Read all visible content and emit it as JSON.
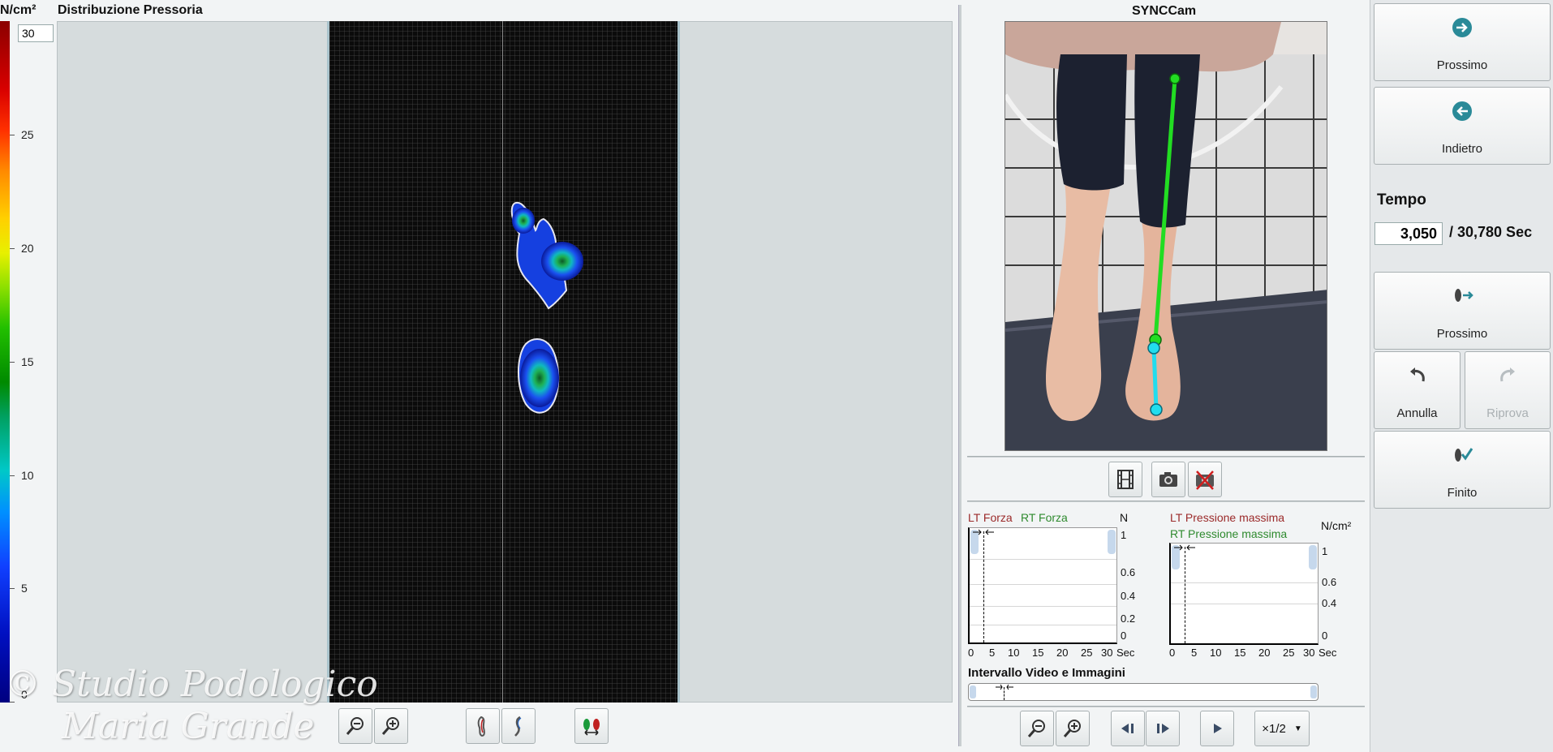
{
  "pressure_panel": {
    "unit": "N/cm²",
    "title": "Distribuzione Pressoria",
    "max_value": "30",
    "scale_ticks": [
      "25",
      "20",
      "15",
      "10",
      "5",
      "0"
    ]
  },
  "watermark": {
    "line1": "© Studio Podologico",
    "line2": "Maria Grande"
  },
  "left_toolbar": {
    "icons": [
      "zoom-out-icon",
      "zoom-in-icon",
      "foot-outline-icon",
      "foot-line-icon",
      "swap-feet-icon"
    ]
  },
  "camera": {
    "title": "SYNCCam"
  },
  "camera_toolbar": {
    "icons": [
      "film-icon",
      "camera-icon",
      "camera-off-icon"
    ]
  },
  "force_graph": {
    "left_label": "LT Forza",
    "right_label": "RT Forza",
    "unit": "N",
    "y_ticks": [
      "1",
      "0.6",
      "0.4",
      "0.2",
      "0"
    ],
    "x_ticks": [
      "0",
      "5",
      "10",
      "15",
      "20",
      "25",
      "30"
    ],
    "x_unit": "Sec"
  },
  "pressure_graph": {
    "left_label": "LT Pressione massima",
    "right_label": "RT Pressione massima",
    "unit": "N/cm²",
    "y_ticks": [
      "1",
      "0.6",
      "0.4",
      "0"
    ],
    "x_ticks": [
      "0",
      "5",
      "10",
      "15",
      "20",
      "25",
      "30"
    ],
    "x_unit": "Sec"
  },
  "interval": {
    "title": "Intervallo Video e Immagini"
  },
  "playback": {
    "speed": "×1/2"
  },
  "sidebar": {
    "next_label": "Prossimo",
    "back_label": "Indietro",
    "tempo_label": "Tempo",
    "tempo_value": "3,050",
    "tempo_total": "/ 30,780 Sec",
    "next_step_label": "Prossimo",
    "undo_label": "Annulla",
    "redo_label": "Riprova",
    "finish_label": "Finito"
  },
  "colors": {
    "left_series": "#9b2a2a",
    "right_series": "#2e8a2e",
    "cam_line_upper": "#22dd22",
    "cam_line_lower": "#22ddee",
    "accent_icon": "#2a8a98"
  }
}
